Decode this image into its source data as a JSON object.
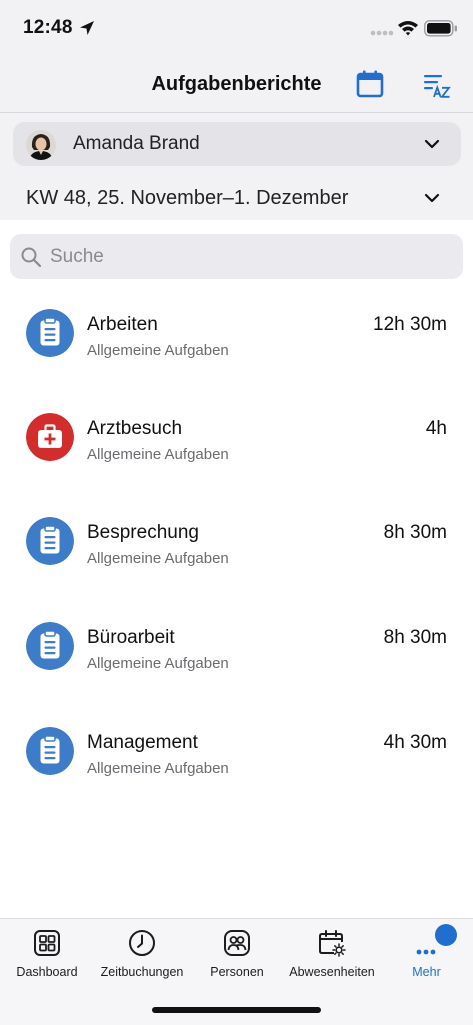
{
  "status_bar": {
    "time": "12:48"
  },
  "nav": {
    "title": "Aufgabenberichte"
  },
  "person": {
    "name": "Amanda Brand"
  },
  "week": {
    "label": "KW 48,  25. November–1. Dezember"
  },
  "search": {
    "placeholder": "Suche"
  },
  "tasks": [
    {
      "title": "Arbeiten",
      "subtitle": "Allgemeine Aufgaben",
      "duration": "12h 30m",
      "icon": "clipboard-icon",
      "color": "#3d7cc9"
    },
    {
      "title": "Arztbesuch",
      "subtitle": "Allgemeine Aufgaben",
      "duration": "4h",
      "icon": "medical-kit-icon",
      "color": "#d42b2b"
    },
    {
      "title": "Besprechung",
      "subtitle": "Allgemeine Aufgaben",
      "duration": "8h 30m",
      "icon": "clipboard-icon",
      "color": "#3d7cc9"
    },
    {
      "title": "Büroarbeit",
      "subtitle": "Allgemeine Aufgaben",
      "duration": "8h 30m",
      "icon": "clipboard-icon",
      "color": "#3d7cc9"
    },
    {
      "title": "Management",
      "subtitle": "Allgemeine Aufgaben",
      "duration": "4h 30m",
      "icon": "clipboard-icon",
      "color": "#3d7cc9"
    }
  ],
  "tabbar": {
    "items": [
      {
        "label": "Dashboard",
        "icon": "grid-icon"
      },
      {
        "label": "Zeitbuchungen",
        "icon": "clock-icon"
      },
      {
        "label": "Personen",
        "icon": "people-icon"
      },
      {
        "label": "Abwesenheiten",
        "icon": "calendar-sun-icon"
      },
      {
        "label": "Mehr",
        "icon": "more-icon",
        "active": true
      }
    ],
    "active_color": "#1f6fd1"
  },
  "colors": {
    "accent": "#1f6fd1",
    "header_bg": "#f2f2f4"
  }
}
